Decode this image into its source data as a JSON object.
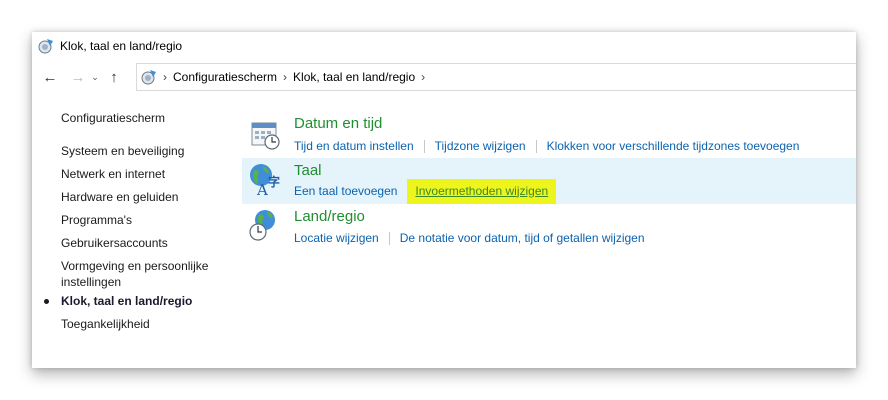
{
  "window": {
    "title": "Klok, taal en land/regio"
  },
  "navigation": {
    "breadcrumbs": [
      "Configuratiescherm",
      "Klok, taal en land/regio"
    ]
  },
  "sidebar": {
    "home": "Configuratiescherm",
    "items": [
      {
        "label": "Systeem en beveiliging"
      },
      {
        "label": "Netwerk en internet"
      },
      {
        "label": "Hardware en geluiden"
      },
      {
        "label": "Programma's"
      },
      {
        "label": "Gebruikersaccounts"
      },
      {
        "label": "Vormgeving en persoonlijke",
        "label2": "instellingen"
      },
      {
        "label": "Klok, taal en land/regio",
        "active": true
      },
      {
        "label": "Toegankelijkheid"
      }
    ]
  },
  "categories": [
    {
      "title": "Datum en tijd",
      "icon": "calendar-clock-icon",
      "links": [
        "Tijd en datum instellen",
        "Tijdzone wijzigen",
        "Klokken voor verschillende tijdzones toevoegen"
      ]
    },
    {
      "title": "Taal",
      "icon": "language-icon",
      "links": [
        "Een taal toevoegen",
        "Invoermethoden wijzigen"
      ],
      "highlight_color": "#eef51c"
    },
    {
      "title": "Land/regio",
      "icon": "globe-clock-icon",
      "links": [
        "Locatie wijzigen",
        "De notatie voor datum, tijd of getallen wijzigen"
      ]
    }
  ],
  "colors": {
    "link": "#0b63b0",
    "category_title": "#1f8f30",
    "hover_row": "#e5f3fb"
  }
}
